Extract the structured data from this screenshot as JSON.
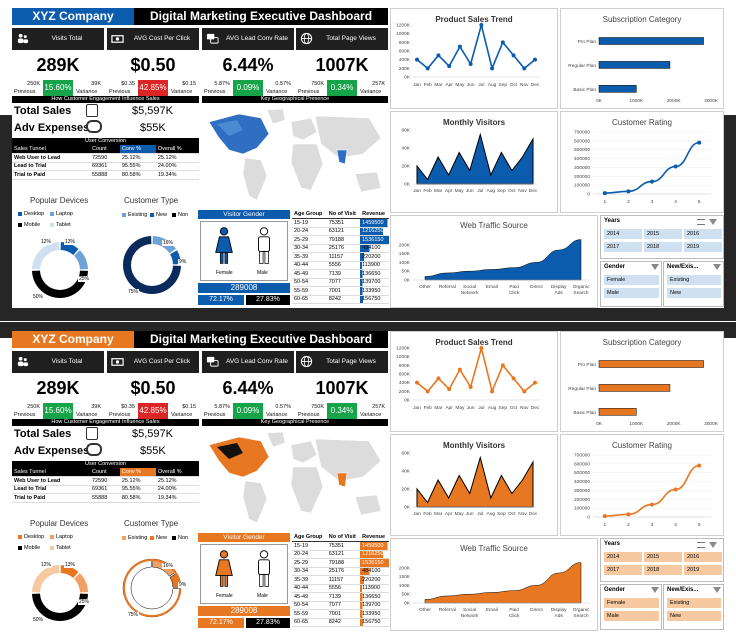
{
  "dashboards": [
    {
      "theme": {
        "accent": "#0b5cad",
        "accent_light": "#cfe0f1",
        "accent_mid": "#6fa3d8",
        "world_highlight": "#2f6fc2",
        "world_dark": "#4a8ad0"
      },
      "company": "XYZ Company",
      "title": "Digital Marketing Executive Dashboard",
      "kpis": [
        {
          "label": "Visits Total",
          "icon": "users-icon",
          "value": "289K",
          "prev": "250K",
          "prev_label": "Previous",
          "pct": "15.60%",
          "pct_color": "#16a34a",
          "var": "39K",
          "var_label": "Variance"
        },
        {
          "label": "AVG Cost Per Click",
          "icon": "money-icon",
          "value": "$0.50",
          "prev": "$0.35",
          "prev_label": "Previous",
          "pct": "42.85%",
          "pct_color": "#dc2626",
          "var": "$0.15",
          "var_label": "Variance"
        },
        {
          "label": "AVG Lead Conv Rate",
          "icon": "chat-icon",
          "value": "6.44%",
          "prev": "5.87%",
          "prev_label": "Previous",
          "pct": "0.09%",
          "pct_color": "#16a34a",
          "var": "0.57%",
          "var_label": "Variance"
        },
        {
          "label": "Total Page Views",
          "icon": "globe-icon",
          "value": "1007K",
          "prev": "750K",
          "prev_label": "Previous",
          "pct": "0.34%",
          "pct_color": "#16a34a",
          "var": "257K",
          "var_label": "Variance"
        }
      ],
      "engagement_title": "How Customer Engagement Influence Sales",
      "geo_title": "Key Geographical Presence",
      "total_sales_label": "Total Sales",
      "total_sales": "$5,597K",
      "adv_label": "Adv Expenses",
      "adv": "$55K",
      "conversion_title": "User Conversion",
      "conversion_headers": [
        "Sales Tunnel",
        "Count",
        "Conv %",
        "Overall %"
      ],
      "conversion_rows": [
        [
          "Web User to Lead",
          "72590",
          "25.12%",
          "25.12%"
        ],
        [
          "Lead to Trial",
          "69361",
          "95.55%",
          "24.00%"
        ],
        [
          "Trial to Paid",
          "55888",
          "80.58%",
          "19.34%"
        ]
      ],
      "devices_title": "Popular Devices",
      "devices_legend": [
        "Desktop",
        "Laptop",
        "Mobile",
        "Tablet"
      ],
      "devices_labels": [
        "12%",
        "13%",
        "25%",
        "50%"
      ],
      "ctype_title": "Customer Type",
      "ctype_legend": [
        "Existing",
        "New",
        "Non"
      ],
      "ctype_labels": [
        "16%",
        "9%",
        "75%"
      ],
      "gender_title": "Visitor Gender",
      "female_label": "Female",
      "male_label": "Male",
      "gender_total": "289008",
      "female_pct": "72.17%",
      "male_pct": "27.83%",
      "age_headers": [
        "Age Group",
        "No of Visit",
        "Revenue"
      ],
      "age_rows": [
        [
          "15-19",
          "75351",
          "1459500"
        ],
        [
          "20-24",
          "63121",
          "1216250"
        ],
        [
          "25-29",
          "79188",
          "1536150"
        ],
        [
          "30-34",
          "25176",
          "484100"
        ],
        [
          "35-39",
          "11157",
          "220200"
        ],
        [
          "40-44",
          "5556",
          "113900"
        ],
        [
          "45-49",
          "7139",
          "136650"
        ],
        [
          "50-54",
          "7077",
          "139700"
        ],
        [
          "55-59",
          "7001",
          "133950"
        ],
        [
          "60-65",
          "8242",
          "156750"
        ]
      ],
      "slicer_years_title": "Years",
      "slicer_years": [
        "2014",
        "2015",
        "2016",
        "2017",
        "2018",
        "2019"
      ],
      "slicer_gender_title": "Gender",
      "slicer_gender": [
        "Female",
        "Male"
      ],
      "slicer_cust_title": "New/Exis...",
      "slicer_cust": [
        "Existing",
        "New"
      ]
    },
    {
      "theme": {
        "accent": "#e87722",
        "accent_light": "#f6c9a1",
        "accent_mid": "#f0a062",
        "world_highlight": "#e87722",
        "world_dark": "#111111"
      },
      "company": "XYZ Company",
      "title": "Digital Marketing Executive Dashboard",
      "kpis": [
        {
          "label": "Visits Total",
          "icon": "users-icon",
          "value": "289K",
          "prev": "250K",
          "prev_label": "Previous",
          "pct": "15.60%",
          "pct_color": "#16a34a",
          "var": "39K",
          "var_label": "Variance"
        },
        {
          "label": "AVG Cost Per Click",
          "icon": "money-icon",
          "value": "$0.50",
          "prev": "$0.35",
          "prev_label": "Previous",
          "pct": "42.85%",
          "pct_color": "#dc2626",
          "var": "$0.15",
          "var_label": "Variance"
        },
        {
          "label": "AVG Lead Conv Rate",
          "icon": "chat-icon",
          "value": "6.44%",
          "prev": "5.87%",
          "prev_label": "Previous",
          "pct": "0.09%",
          "pct_color": "#16a34a",
          "var": "0.57%",
          "var_label": "Variance"
        },
        {
          "label": "Total Page Views",
          "icon": "globe-icon",
          "value": "1007K",
          "prev": "750K",
          "prev_label": "Previous",
          "pct": "0.34%",
          "pct_color": "#16a34a",
          "var": "257K",
          "var_label": "Variance"
        }
      ],
      "engagement_title": "How Customer Engagement Influence Sales",
      "geo_title": "Key Geographical Presence",
      "total_sales_label": "Total Sales",
      "total_sales": "$5,597K",
      "adv_label": "Adv Expenses",
      "adv": "$55K",
      "conversion_title": "User Conversion",
      "conversion_headers": [
        "Sales Tunnel",
        "Count",
        "Conv %",
        "Overall %"
      ],
      "conversion_rows": [
        [
          "Web User to Lead",
          "72590",
          "25.12%",
          "25.12%"
        ],
        [
          "Lead to Trial",
          "69361",
          "95.55%",
          "24.00%"
        ],
        [
          "Trial to Paid",
          "55888",
          "80.58%",
          "19.34%"
        ]
      ],
      "devices_title": "Popular Devices",
      "devices_legend": [
        "Desktop",
        "Laptop",
        "Mobile",
        "Tablet"
      ],
      "devices_labels": [
        "12%",
        "13%",
        "25%",
        "50%"
      ],
      "ctype_title": "Customer Type",
      "ctype_legend": [
        "Existing",
        "New",
        "Non"
      ],
      "ctype_labels": [
        "16%",
        "9%",
        "75%"
      ],
      "gender_title": "Visitor Gender",
      "female_label": "Female",
      "male_label": "Male",
      "gender_total": "289008",
      "female_pct": "72.17%",
      "male_pct": "27.83%",
      "age_headers": [
        "Age Group",
        "No of Visit",
        "Revenue"
      ],
      "age_rows": [
        [
          "15-19",
          "75351",
          "1459500"
        ],
        [
          "20-24",
          "63121",
          "1216250"
        ],
        [
          "25-29",
          "79188",
          "1536150"
        ],
        [
          "30-34",
          "25176",
          "484100"
        ],
        [
          "35-39",
          "11157",
          "220200"
        ],
        [
          "40-44",
          "5556",
          "113900"
        ],
        [
          "45-49",
          "7139",
          "136650"
        ],
        [
          "50-54",
          "7077",
          "139700"
        ],
        [
          "55-59",
          "7001",
          "133950"
        ],
        [
          "60-65",
          "8242",
          "156750"
        ]
      ],
      "slicer_years_title": "Years",
      "slicer_years": [
        "2014",
        "2015",
        "2016",
        "2017",
        "2018",
        "2019"
      ],
      "slicer_gender_title": "Gender",
      "slicer_gender": [
        "Female",
        "Male"
      ],
      "slicer_cust_title": "New/Exis...",
      "slicer_cust": [
        "Existing",
        "New"
      ]
    }
  ],
  "chart_data": [
    {
      "type": "line",
      "title": "Product Sales Trend",
      "categories": [
        "Jan",
        "Feb",
        "Mar",
        "Apr",
        "May",
        "Jun",
        "Jul",
        "Aug",
        "Sep",
        "Oct",
        "Nov",
        "Dec"
      ],
      "values": [
        400000,
        200000,
        500000,
        250000,
        700000,
        300000,
        1200000,
        200000,
        800000,
        500000,
        200000,
        400000
      ],
      "ylim": [
        0,
        1200000
      ],
      "yticks": [
        "0K",
        "200K",
        "400K",
        "600K",
        "800K",
        "1000K",
        "1200K"
      ]
    },
    {
      "type": "bar",
      "title": "Subscription Category",
      "orientation": "horizontal",
      "categories": [
        "Pro Plan",
        "Regular Plan",
        "Basic Plan"
      ],
      "values": [
        2800000,
        1900000,
        1000000
      ],
      "ylim": [
        0,
        3000000
      ],
      "xticks": [
        "0K",
        "1000K",
        "2000K",
        "3000K"
      ]
    },
    {
      "type": "area",
      "title": "Monthly Visitors",
      "categories": [
        "Jan",
        "Feb",
        "Mar",
        "Apr",
        "May",
        "Jun",
        "Jul",
        "Aug",
        "Sep",
        "Oct",
        "Nov",
        "Dec"
      ],
      "values": [
        20000,
        5000,
        30000,
        10000,
        35000,
        15000,
        55000,
        10000,
        35000,
        15000,
        30000,
        50000
      ],
      "ylim": [
        0,
        60000
      ],
      "yticks": [
        "0K",
        "20K",
        "40K",
        "60K"
      ]
    },
    {
      "type": "line",
      "title": "Customer Rating",
      "categories": [
        "1",
        "2",
        "3",
        "4",
        "5"
      ],
      "values": [
        10000,
        30000,
        140000,
        310000,
        580000
      ],
      "ylim": [
        0,
        700000
      ],
      "yticks": [
        "0",
        "100000",
        "200000",
        "300000",
        "400000",
        "500000",
        "600000",
        "700000"
      ]
    },
    {
      "type": "area",
      "title": "Web Traffic Source",
      "categories": [
        "Other",
        "Referral",
        "Social Network",
        "Email",
        "Paid Click",
        "Direct",
        "Display Ads",
        "Organic Search"
      ],
      "values": [
        20000,
        40000,
        50000,
        60000,
        70000,
        100000,
        170000,
        230000
      ],
      "ylim": [
        0,
        250000
      ],
      "yticks": [
        "0K",
        "50K",
        "100K",
        "150K",
        "200K"
      ]
    },
    {
      "type": "pie",
      "title": "Popular Devices",
      "categories": [
        "Desktop",
        "Laptop",
        "Mobile",
        "Tablet"
      ],
      "values": [
        12,
        13,
        50,
        25
      ]
    },
    {
      "type": "pie",
      "title": "Customer Type",
      "categories": [
        "Existing",
        "New",
        "Non"
      ],
      "values": [
        16,
        9,
        75
      ]
    }
  ]
}
